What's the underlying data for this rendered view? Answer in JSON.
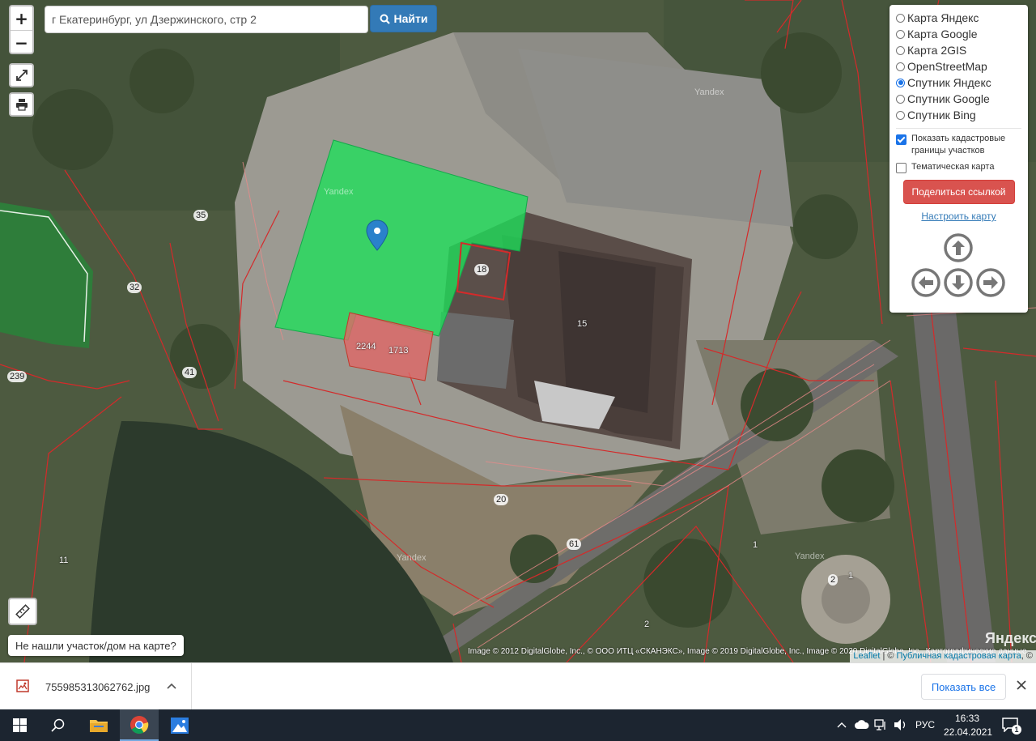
{
  "search": {
    "value": "г Екатеринбург, ул Дзержинского, стр 2",
    "button_label": "Найти"
  },
  "zoom": {
    "in": "+",
    "out": "−"
  },
  "layers": {
    "items": [
      {
        "label": "Карта Яндекс",
        "selected": false
      },
      {
        "label": "Карта Google",
        "selected": false
      },
      {
        "label": "Карта 2GIS",
        "selected": false
      },
      {
        "label": "OpenStreetMap",
        "selected": false
      },
      {
        "label": "Спутник Яндекс",
        "selected": true
      },
      {
        "label": "Спутник Google",
        "selected": false
      },
      {
        "label": "Спутник Bing",
        "selected": false
      }
    ],
    "show_cadastral_label": "Показать кадастровые границы участков",
    "show_cadastral_checked": true,
    "thematic_label": "Тематическая карта",
    "thematic_checked": false,
    "share_label": "Поделиться ссылкой",
    "configure_label": "Настроить карту"
  },
  "parcels": [
    "35",
    "32",
    "239",
    "41",
    "18",
    "15",
    "2244",
    "1713",
    "20",
    "61",
    "11",
    "1",
    "2",
    "1",
    "2"
  ],
  "watermark": "Yandex",
  "not_found_label": "Не нашли участок/дом на карте?",
  "attribution": {
    "imagery": "Image © 2012 DigitalGlobe, Inc., © ООО ИТЦ «СКАНЭКС», Image © 2019 DigitalGlobe, Inc., Image © 2020 DigitalGlobe, Inc., Картографические данные",
    "yandex_logo": "Яндекс",
    "leaflet": "Leaflet",
    "separator": "| ©",
    "source": "Публичная кадастровая карта",
    "suffix": ", ©"
  },
  "download": {
    "file_name": "755985313062762.jpg",
    "show_all": "Показать все"
  },
  "taskbar": {
    "lang": "РУС",
    "time": "16:33",
    "date": "22.04.2021",
    "notifications": "1"
  },
  "colors": {
    "highlight_green": "#1ee05a",
    "highlight_red": "#e06767",
    "parcel_border": "#d42a2a",
    "accent_blue": "#337ab7",
    "share_red": "#d9534f"
  }
}
